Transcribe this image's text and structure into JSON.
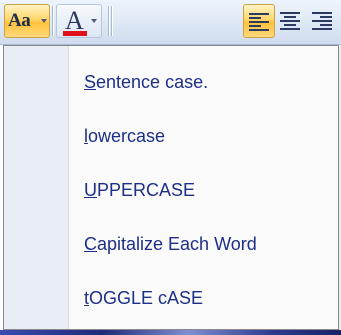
{
  "toolbar": {
    "change_case_glyph": "Aa",
    "font_color_glyph": "A",
    "font_color": "#e0101c",
    "accent_active": "#ffc23a"
  },
  "menu": {
    "items": [
      {
        "hotkey": "S",
        "rest": "entence case."
      },
      {
        "hotkey": "l",
        "rest": "owercase"
      },
      {
        "hotkey": "U",
        "rest": "PPERCASE"
      },
      {
        "hotkey": "C",
        "rest": "apitalize Each Word"
      },
      {
        "hotkey": "t",
        "rest": "OGGLE cASE"
      }
    ]
  }
}
